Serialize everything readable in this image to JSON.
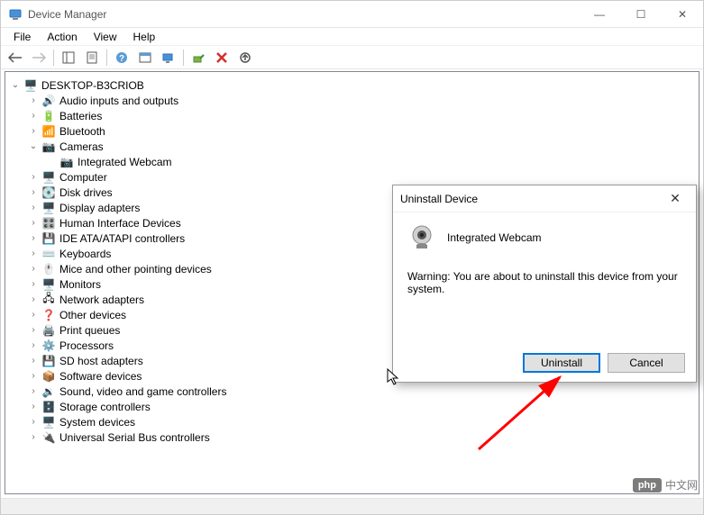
{
  "window": {
    "title": "Device Manager"
  },
  "menubar": [
    "File",
    "Action",
    "View",
    "Help"
  ],
  "tree": {
    "root": "DESKTOP-B3CRIOB",
    "items": [
      {
        "label": "Audio inputs and outputs",
        "icon": "audio",
        "expanded": false
      },
      {
        "label": "Batteries",
        "icon": "battery",
        "expanded": false
      },
      {
        "label": "Bluetooth",
        "icon": "bluetooth",
        "expanded": false
      },
      {
        "label": "Cameras",
        "icon": "camera",
        "expanded": true,
        "children": [
          {
            "label": "Integrated Webcam",
            "icon": "camera"
          }
        ]
      },
      {
        "label": "Computer",
        "icon": "computer",
        "expanded": false
      },
      {
        "label": "Disk drives",
        "icon": "disk",
        "expanded": false
      },
      {
        "label": "Display adapters",
        "icon": "display",
        "expanded": false
      },
      {
        "label": "Human Interface Devices",
        "icon": "hid",
        "expanded": false
      },
      {
        "label": "IDE ATA/ATAPI controllers",
        "icon": "ide",
        "expanded": false
      },
      {
        "label": "Keyboards",
        "icon": "keyboard",
        "expanded": false
      },
      {
        "label": "Mice and other pointing devices",
        "icon": "mouse",
        "expanded": false
      },
      {
        "label": "Monitors",
        "icon": "monitor",
        "expanded": false
      },
      {
        "label": "Network adapters",
        "icon": "network",
        "expanded": false
      },
      {
        "label": "Other devices",
        "icon": "other",
        "expanded": false
      },
      {
        "label": "Print queues",
        "icon": "printer",
        "expanded": false
      },
      {
        "label": "Processors",
        "icon": "cpu",
        "expanded": false
      },
      {
        "label": "SD host adapters",
        "icon": "sd",
        "expanded": false
      },
      {
        "label": "Software devices",
        "icon": "software",
        "expanded": false
      },
      {
        "label": "Sound, video and game controllers",
        "icon": "sound",
        "expanded": false
      },
      {
        "label": "Storage controllers",
        "icon": "storage",
        "expanded": false
      },
      {
        "label": "System devices",
        "icon": "system",
        "expanded": false
      },
      {
        "label": "Universal Serial Bus controllers",
        "icon": "usb",
        "expanded": false
      }
    ]
  },
  "dialog": {
    "title": "Uninstall Device",
    "device_name": "Integrated Webcam",
    "warning": "Warning: You are about to uninstall this device from your system.",
    "uninstall_label": "Uninstall",
    "cancel_label": "Cancel"
  },
  "watermark": {
    "logo": "php",
    "text": "中文网"
  },
  "glyphs": {
    "minimize": "—",
    "maximize": "☐",
    "close": "✕",
    "twisty_open": "⌄",
    "twisty_closed": "›"
  },
  "icons": {
    "audio": "🔊",
    "battery": "🔋",
    "bluetooth": "📶",
    "camera": "📷",
    "computer": "🖥️",
    "disk": "💽",
    "display": "🖥️",
    "hid": "🎛️",
    "ide": "💾",
    "keyboard": "⌨️",
    "mouse": "🖱️",
    "monitor": "🖥️",
    "network": "🖧",
    "other": "❓",
    "printer": "🖨️",
    "cpu": "⚙️",
    "sd": "💾",
    "software": "📦",
    "sound": "🔉",
    "storage": "🗄️",
    "system": "🖥️",
    "usb": "🔌",
    "root": "🖥️"
  }
}
